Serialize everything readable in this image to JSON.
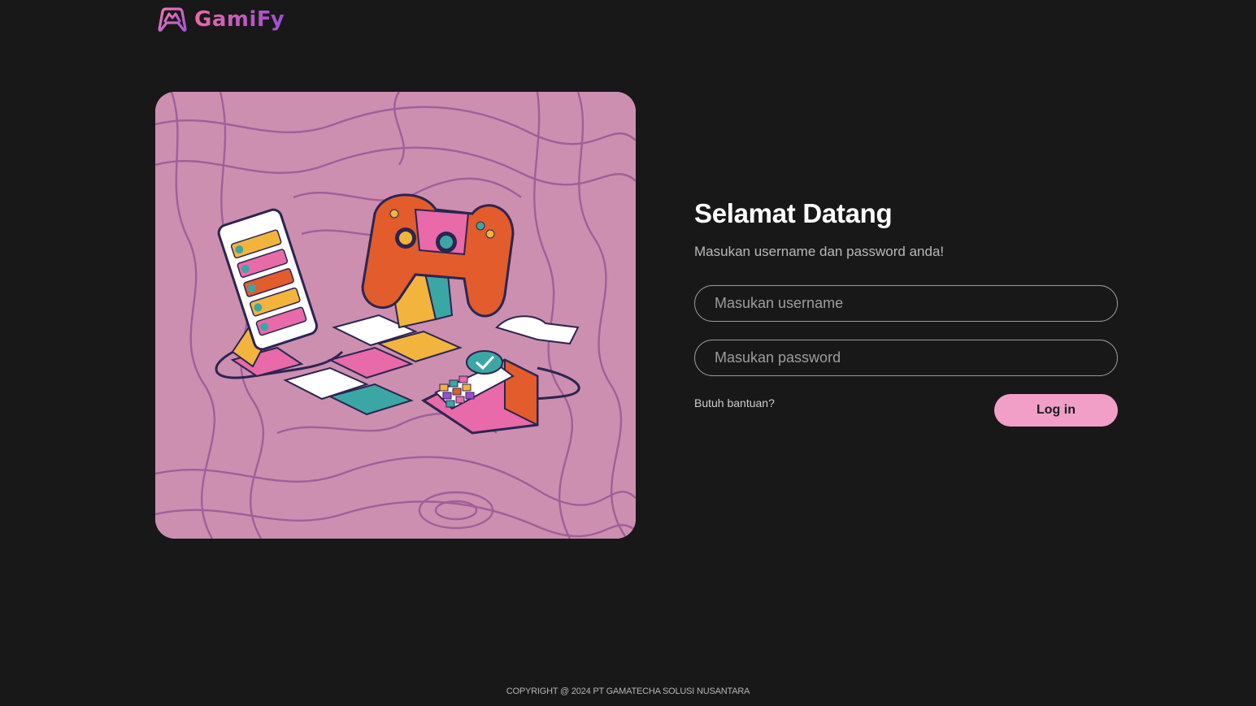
{
  "brand": {
    "name": "GamiFy",
    "logo_icon": "gamepad-logo-icon",
    "gradient_start": "#e86aa8",
    "gradient_end": "#9b4fd0"
  },
  "hero": {
    "image_icon": "gaming-devices-illustration",
    "background_color": "#cc8fb0"
  },
  "login": {
    "title": "Selamat Datang",
    "subtitle": "Masukan username dan password anda!",
    "username_placeholder": "Masukan username",
    "username_value": "",
    "password_placeholder": "Masukan password",
    "password_value": "",
    "help_link": "Butuh bantuan?",
    "submit_label": "Log in",
    "accent_color": "#f19fc7"
  },
  "footer": {
    "copyright": "COPYRIGHT @ 2024 PT GAMATECHA SOLUSI NUSANTARA"
  },
  "colors": {
    "background": "#181818",
    "text_primary": "#ffffff",
    "text_secondary": "#b9b9b9"
  }
}
